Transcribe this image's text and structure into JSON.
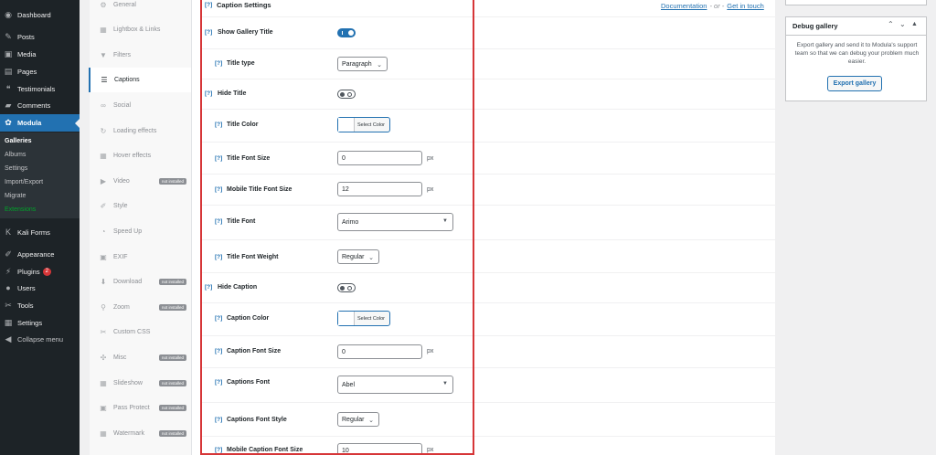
{
  "admin_menu": {
    "items": [
      {
        "label": "Dashboard",
        "icon": "dashboard-icon",
        "glyph": "◉"
      },
      {
        "label": "Posts",
        "icon": "pin-icon",
        "glyph": "✎"
      },
      {
        "label": "Media",
        "icon": "media-icon",
        "glyph": "▣"
      },
      {
        "label": "Pages",
        "icon": "pages-icon",
        "glyph": "▤"
      },
      {
        "label": "Testimonials",
        "icon": "quote-icon",
        "glyph": "❝"
      },
      {
        "label": "Comments",
        "icon": "comments-icon",
        "glyph": "▰"
      },
      {
        "label": "Modula",
        "icon": "gear-icon",
        "glyph": "✿"
      },
      {
        "label": "Kali Forms",
        "icon": "k-icon",
        "glyph": "K"
      },
      {
        "label": "Appearance",
        "icon": "brush-icon",
        "glyph": "✐"
      },
      {
        "label": "Plugins",
        "icon": "plug-icon",
        "glyph": "⚡",
        "badge": "2"
      },
      {
        "label": "Users",
        "icon": "user-icon",
        "glyph": "●"
      },
      {
        "label": "Tools",
        "icon": "wrench-icon",
        "glyph": "✂"
      },
      {
        "label": "Settings",
        "icon": "settings-icon",
        "glyph": "▦"
      },
      {
        "label": "Collapse menu",
        "icon": "collapse-icon",
        "glyph": "◀"
      }
    ],
    "submenu": [
      "Galleries",
      "Albums",
      "Settings",
      "Import/Export",
      "Migrate",
      "Extensions"
    ]
  },
  "tabs": [
    {
      "label": "General",
      "icon": "gear-icon",
      "glyph": "⚙"
    },
    {
      "label": "Lightbox & Links",
      "icon": "grid-icon",
      "glyph": "▦"
    },
    {
      "label": "Filters",
      "icon": "filter-icon",
      "glyph": "▼"
    },
    {
      "label": "Captions",
      "icon": "text-align-icon",
      "glyph": "☰"
    },
    {
      "label": "Social",
      "icon": "link-icon",
      "glyph": "∞"
    },
    {
      "label": "Loading effects",
      "icon": "refresh-icon",
      "glyph": "↻"
    },
    {
      "label": "Hover effects",
      "icon": "grid-icon",
      "glyph": "▦"
    },
    {
      "label": "Video",
      "icon": "video-icon",
      "glyph": "▶",
      "badge": "not installed"
    },
    {
      "label": "Style",
      "icon": "brush-icon",
      "glyph": "✐"
    },
    {
      "label": "Speed Up",
      "icon": "dashboard-icon",
      "glyph": "◔"
    },
    {
      "label": "EXIF",
      "icon": "camera-icon",
      "glyph": "▣"
    },
    {
      "label": "Download",
      "icon": "download-icon",
      "glyph": "⬇",
      "badge": "not installed"
    },
    {
      "label": "Zoom",
      "icon": "zoom-icon",
      "glyph": "⚲",
      "badge": "not installed"
    },
    {
      "label": "Custom CSS",
      "icon": "wrench-icon",
      "glyph": "✂"
    },
    {
      "label": "Misc",
      "icon": "misc-icon",
      "glyph": "✣",
      "badge": "not installed"
    },
    {
      "label": "Slideshow",
      "icon": "slideshow-icon",
      "glyph": "▦",
      "badge": "not installed"
    },
    {
      "label": "Pass Protect",
      "icon": "lock-icon",
      "glyph": "▣",
      "badge": "not installed"
    },
    {
      "label": "Watermark",
      "icon": "image-icon",
      "glyph": "▦",
      "badge": "not installed"
    }
  ],
  "panel": {
    "title": "Caption Settings",
    "documentation": "Documentation",
    "or": "- or -",
    "get_in_touch": "Get in touch",
    "help_glyph": "[?]"
  },
  "fields": {
    "show_gallery_title": {
      "label": "Show Gallery Title",
      "state": "on"
    },
    "title_type": {
      "label": "Title type",
      "value": "Paragraph"
    },
    "hide_title": {
      "label": "Hide Title",
      "state": "off"
    },
    "title_color": {
      "label": "Title Color",
      "button": "Select Color"
    },
    "title_font_size": {
      "label": "Title Font Size",
      "value": "0",
      "unit": "px"
    },
    "mobile_title_font_size": {
      "label": "Mobile Title Font Size",
      "value": "12",
      "unit": "px"
    },
    "title_font": {
      "label": "Title Font",
      "value": "Arimo"
    },
    "title_font_weight": {
      "label": "Title Font Weight",
      "value": "Regular"
    },
    "hide_caption": {
      "label": "Hide Caption",
      "state": "off"
    },
    "caption_color": {
      "label": "Caption Color",
      "button": "Select Color"
    },
    "caption_font_size": {
      "label": "Caption Font Size",
      "value": "0",
      "unit": "px"
    },
    "captions_font": {
      "label": "Captions Font",
      "value": "Abel"
    },
    "captions_font_style": {
      "label": "Captions Font Style",
      "value": "Regular"
    },
    "mobile_caption_font_size": {
      "label": "Mobile Caption Font Size",
      "value": "10",
      "unit": "px"
    }
  },
  "debug": {
    "title": "Debug gallery",
    "description": "Export gallery and send it to Modula's support team so that we can debug your problem much easier.",
    "button": "Export gallery"
  }
}
